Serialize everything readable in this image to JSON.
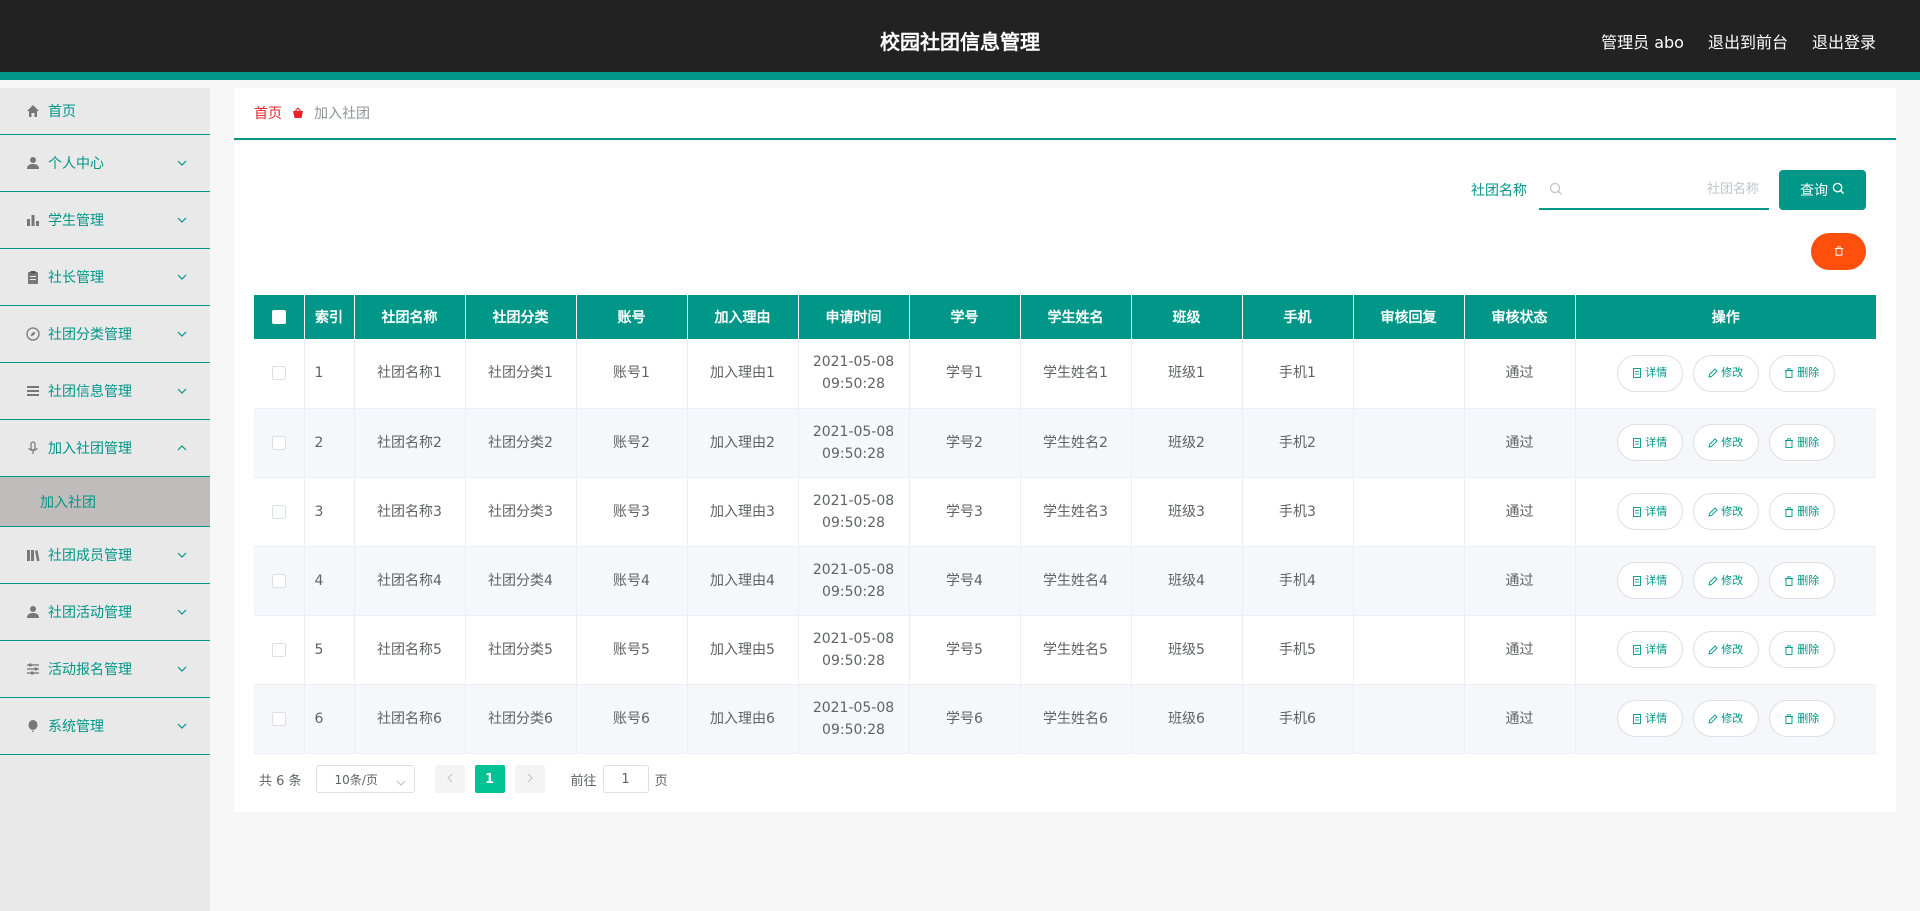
{
  "header": {
    "title": "校园社团信息管理",
    "user": "管理员 abo",
    "front": "退出到前台",
    "logout": "退出登录"
  },
  "sidebar": {
    "items": [
      {
        "label": "首页",
        "icon": "home-icon"
      },
      {
        "label": "个人中心",
        "icon": "user-icon"
      },
      {
        "label": "学生管理",
        "icon": "bar-chart-icon"
      },
      {
        "label": "社长管理",
        "icon": "clipboard-icon"
      },
      {
        "label": "社团分类管理",
        "icon": "compass-icon"
      },
      {
        "label": "社团信息管理",
        "icon": "list-icon"
      },
      {
        "label": "加入社团管理",
        "icon": "microphone-icon"
      },
      {
        "label": "社团成员管理",
        "icon": "library-icon"
      },
      {
        "label": "社团活动管理",
        "icon": "user-icon"
      },
      {
        "label": "活动报名管理",
        "icon": "sliders-icon"
      },
      {
        "label": "系统管理",
        "icon": "balloon-icon"
      }
    ],
    "submenu_label": "加入社团"
  },
  "breadcrumb": {
    "home": "首页",
    "current": "加入社团"
  },
  "search": {
    "label": "社团名称",
    "placeholder": "社团名称",
    "button": "查询"
  },
  "table": {
    "headers": [
      "索引",
      "社团名称",
      "社团分类",
      "账号",
      "加入理由",
      "申请时间",
      "学号",
      "学生姓名",
      "班级",
      "手机",
      "审核回复",
      "审核状态",
      "操作"
    ],
    "rows": [
      {
        "index": "1",
        "name": "社团名称1",
        "category": "社团分类1",
        "account": "账号1",
        "reason": "加入理由1",
        "date": "2021-05-08",
        "time": "09:50:28",
        "student_no": "学号1",
        "student_name": "学生姓名1",
        "class": "班级1",
        "phone": "手机1",
        "reply": "",
        "status": "通过"
      },
      {
        "index": "2",
        "name": "社团名称2",
        "category": "社团分类2",
        "account": "账号2",
        "reason": "加入理由2",
        "date": "2021-05-08",
        "time": "09:50:28",
        "student_no": "学号2",
        "student_name": "学生姓名2",
        "class": "班级2",
        "phone": "手机2",
        "reply": "",
        "status": "通过"
      },
      {
        "index": "3",
        "name": "社团名称3",
        "category": "社团分类3",
        "account": "账号3",
        "reason": "加入理由3",
        "date": "2021-05-08",
        "time": "09:50:28",
        "student_no": "学号3",
        "student_name": "学生姓名3",
        "class": "班级3",
        "phone": "手机3",
        "reply": "",
        "status": "通过"
      },
      {
        "index": "4",
        "name": "社团名称4",
        "category": "社团分类4",
        "account": "账号4",
        "reason": "加入理由4",
        "date": "2021-05-08",
        "time": "09:50:28",
        "student_no": "学号4",
        "student_name": "学生姓名4",
        "class": "班级4",
        "phone": "手机4",
        "reply": "",
        "status": "通过"
      },
      {
        "index": "5",
        "name": "社团名称5",
        "category": "社团分类5",
        "account": "账号5",
        "reason": "加入理由5",
        "date": "2021-05-08",
        "time": "09:50:28",
        "student_no": "学号5",
        "student_name": "学生姓名5",
        "class": "班级5",
        "phone": "手机5",
        "reply": "",
        "status": "通过"
      },
      {
        "index": "6",
        "name": "社团名称6",
        "category": "社团分类6",
        "account": "账号6",
        "reason": "加入理由6",
        "date": "2021-05-08",
        "time": "09:50:28",
        "student_no": "学号6",
        "student_name": "学生姓名6",
        "class": "班级6",
        "phone": "手机6",
        "reply": "",
        "status": "通过"
      }
    ],
    "actions": {
      "detail": "详情",
      "edit": "修改",
      "delete": "删除"
    }
  },
  "pagination": {
    "total": "共 6 条",
    "page_size": "10条/页",
    "current_page": "1",
    "goto_label": "前往",
    "goto_value": "1",
    "page_suffix": "页"
  },
  "colors": {
    "primary": "#009688",
    "header_bg": "#222222",
    "danger": "#ff4f0d",
    "page_active": "#00c292"
  }
}
